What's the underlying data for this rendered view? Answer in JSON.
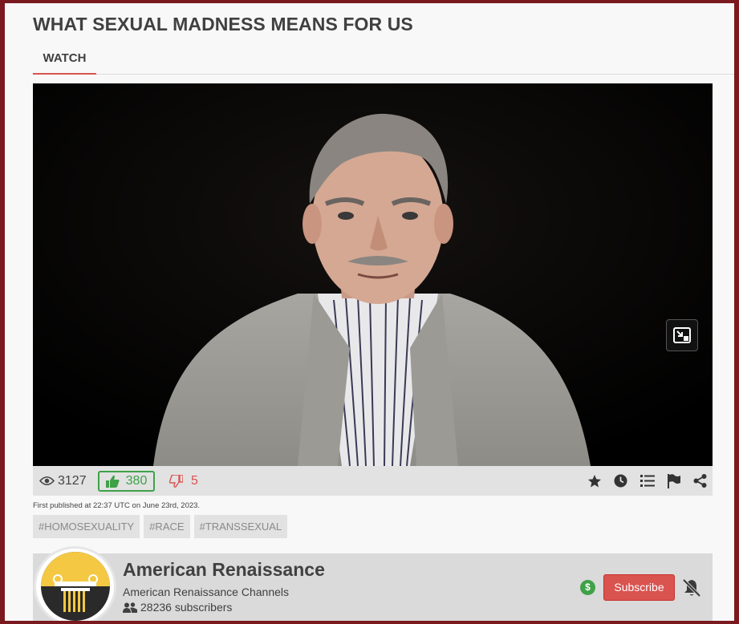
{
  "page": {
    "title": "WHAT SEXUAL MADNESS MEANS FOR US",
    "tabs": [
      {
        "label": "WATCH",
        "active": true
      }
    ]
  },
  "video": {
    "description_icon": "picture-in-picture-icon"
  },
  "stats": {
    "views": "3127",
    "likes": "380",
    "dislikes": "5",
    "actions": [
      "star-icon",
      "clock-icon",
      "playlist-icon",
      "flag-icon",
      "share-icon"
    ]
  },
  "published": "First published at 22:37 UTC on June 23rd, 2023.",
  "tags": [
    "#HOMOSEXUALITY",
    "#RACE",
    "#TRANSSEXUAL"
  ],
  "channel": {
    "name": "American Renaissance",
    "subtitle": "American Renaissance Channels",
    "subscribers": "28236 subscribers",
    "tip_symbol": "$",
    "subscribe_label": "Subscribe"
  },
  "colors": {
    "accent_red": "#d9534f",
    "like_green": "#3fa148",
    "frame": "#7a1a1f"
  }
}
